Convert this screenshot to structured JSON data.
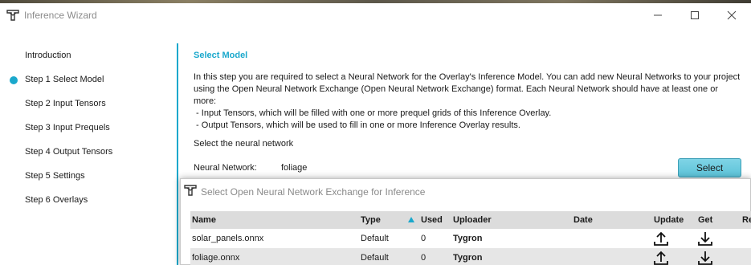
{
  "window": {
    "title": "Inference Wizard",
    "icons": {
      "app": "tygron-logo-icon",
      "minimize": "minimize-icon",
      "maximize": "maximize-icon",
      "close": "close-icon"
    }
  },
  "sidebar": {
    "items": [
      {
        "label": "Introduction",
        "active": false
      },
      {
        "label": "Step 1 Select Model",
        "active": true
      },
      {
        "label": "Step 2 Input Tensors",
        "active": false
      },
      {
        "label": "Step 3 Input Prequels",
        "active": false
      },
      {
        "label": "Step 4 Output Tensors",
        "active": false
      },
      {
        "label": "Step 5 Settings",
        "active": false
      },
      {
        "label": "Step 6 Overlays",
        "active": false
      }
    ],
    "active_indicator_color": "#1aa8cc"
  },
  "main": {
    "section_title": "Select Model",
    "description_lines": [
      "In this step you are required to select a Neural Network for the Overlay's Inference Model. You can add new Neural Networks to your project",
      "using the Open Neural Network Exchange (Open Neural Network Exchange) format. Each Neural Network should have at least one or",
      "more:",
      " - Input Tensors, which will be filled with one or more prequel grids of this Inference Overlay.",
      " - Output Tensors, which will be used to fill in one or more Inference Overlay results."
    ],
    "select_prompt": "Select the neural network",
    "neural_network_label": "Neural Network:",
    "neural_network_value": "foliage",
    "select_button": "Select",
    "accent_color": "#1aa8cc"
  },
  "dialog": {
    "title": "Select Open Neural Network Exchange for Inference",
    "icon": "tygron-logo-icon",
    "columns": [
      "Name",
      "Type",
      "Used",
      "Uploader",
      "Date",
      "Update",
      "Get",
      "Re"
    ],
    "sort_column": "Used",
    "sort_icon": "sort-ascending-icon",
    "rows": [
      {
        "name": "solar_panels.onnx",
        "type": "Default",
        "used": "0",
        "uploader": "Tygron",
        "date": "",
        "update_icon": "upload-icon",
        "get_icon": "download-icon"
      },
      {
        "name": "foliage.onnx",
        "type": "Default",
        "used": "0",
        "uploader": "Tygron",
        "date": "",
        "update_icon": "upload-icon",
        "get_icon": "download-icon"
      }
    ]
  }
}
